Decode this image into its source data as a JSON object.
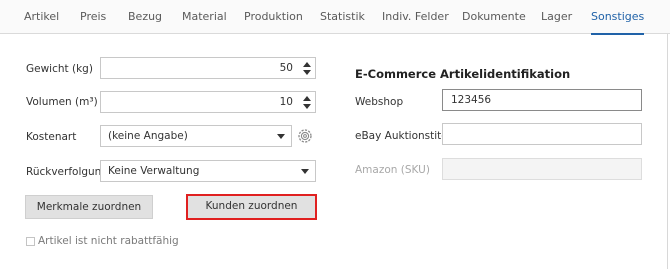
{
  "tabs": [
    {
      "label": "Artikel",
      "active": false
    },
    {
      "label": "Preis",
      "active": false
    },
    {
      "label": "Bezug",
      "active": false
    },
    {
      "label": "Material",
      "active": false
    },
    {
      "label": "Produktion",
      "active": false
    },
    {
      "label": "Statistik",
      "active": false
    },
    {
      "label": "Indiv. Felder",
      "active": false
    },
    {
      "label": "Dokumente",
      "active": false
    },
    {
      "label": "Lager",
      "active": false
    },
    {
      "label": "Sonstiges",
      "active": true
    }
  ],
  "accent_color": "#2062a8",
  "highlight_color": "#e02020",
  "left": {
    "gewicht": {
      "label": "Gewicht (kg)",
      "value": "50"
    },
    "volumen": {
      "label": "Volumen (m³)",
      "value": "10"
    },
    "kostenart": {
      "label": "Kostenart",
      "selected": "(keine Angabe)",
      "settings_icon": "gear-icon"
    },
    "rueckverfolgung": {
      "label": "Rückverfolgung",
      "selected": "Keine Verwaltung"
    },
    "buttons": {
      "merkmale": "Merkmale zuordnen",
      "kunden": "Kunden zuordnen"
    },
    "checkbox": {
      "label": "Artikel ist nicht rabattfähig",
      "checked": false
    }
  },
  "right": {
    "heading": "E-Commerce Artikelidentifikation",
    "webshop": {
      "label": "Webshop",
      "value": "123456"
    },
    "ebay": {
      "label": "eBay Auktionstitel",
      "value": ""
    },
    "amazon": {
      "label": "Amazon (SKU)",
      "value": "",
      "disabled": true
    }
  }
}
